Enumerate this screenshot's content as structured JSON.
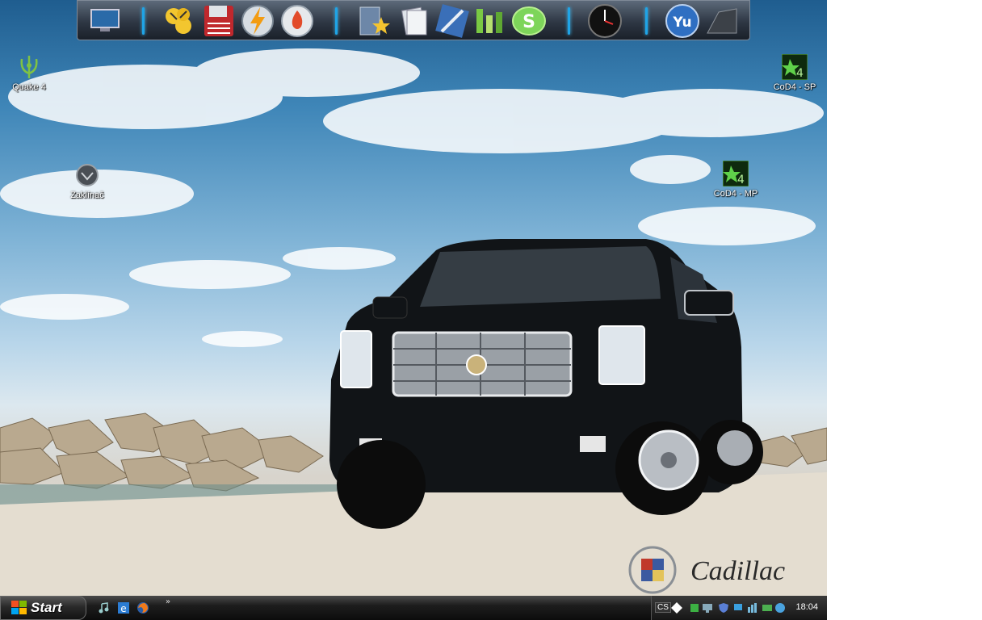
{
  "desktop": {
    "icons": [
      {
        "label": "Quake 4",
        "icon": "quake4-icon"
      },
      {
        "label": "Zaklínač",
        "icon": "witcher-icon"
      },
      {
        "label": "CoD4 - SP",
        "icon": "cod4-sp-icon"
      },
      {
        "label": "CoD4 - MP",
        "icon": "cod4-mp-icon"
      }
    ],
    "wallpaper": {
      "brand_text": "Cadillac",
      "subject": "black-cadillac-suv"
    }
  },
  "dock": {
    "items": [
      "monitor-icon",
      "tools-icon",
      "floppy-save-icon",
      "lightning-icon",
      "fire-disc-icon",
      "favorites-folder-icon",
      "documents-icon",
      "pen-app-icon",
      "qip-icon",
      "skype-icon",
      "clock-widget-icon",
      "yu-icon",
      "shadow-folder-icon"
    ]
  },
  "taskbar": {
    "start_label": "Start",
    "quicklaunch": [
      "media-player-icon",
      "internet-explorer-icon",
      "firefox-icon"
    ],
    "overflow": "»",
    "tray": {
      "lang": "CS",
      "clock": "18:04"
    }
  },
  "colors": {
    "accent": "#1fa4e6",
    "taskbar": "#1d1d1d"
  }
}
